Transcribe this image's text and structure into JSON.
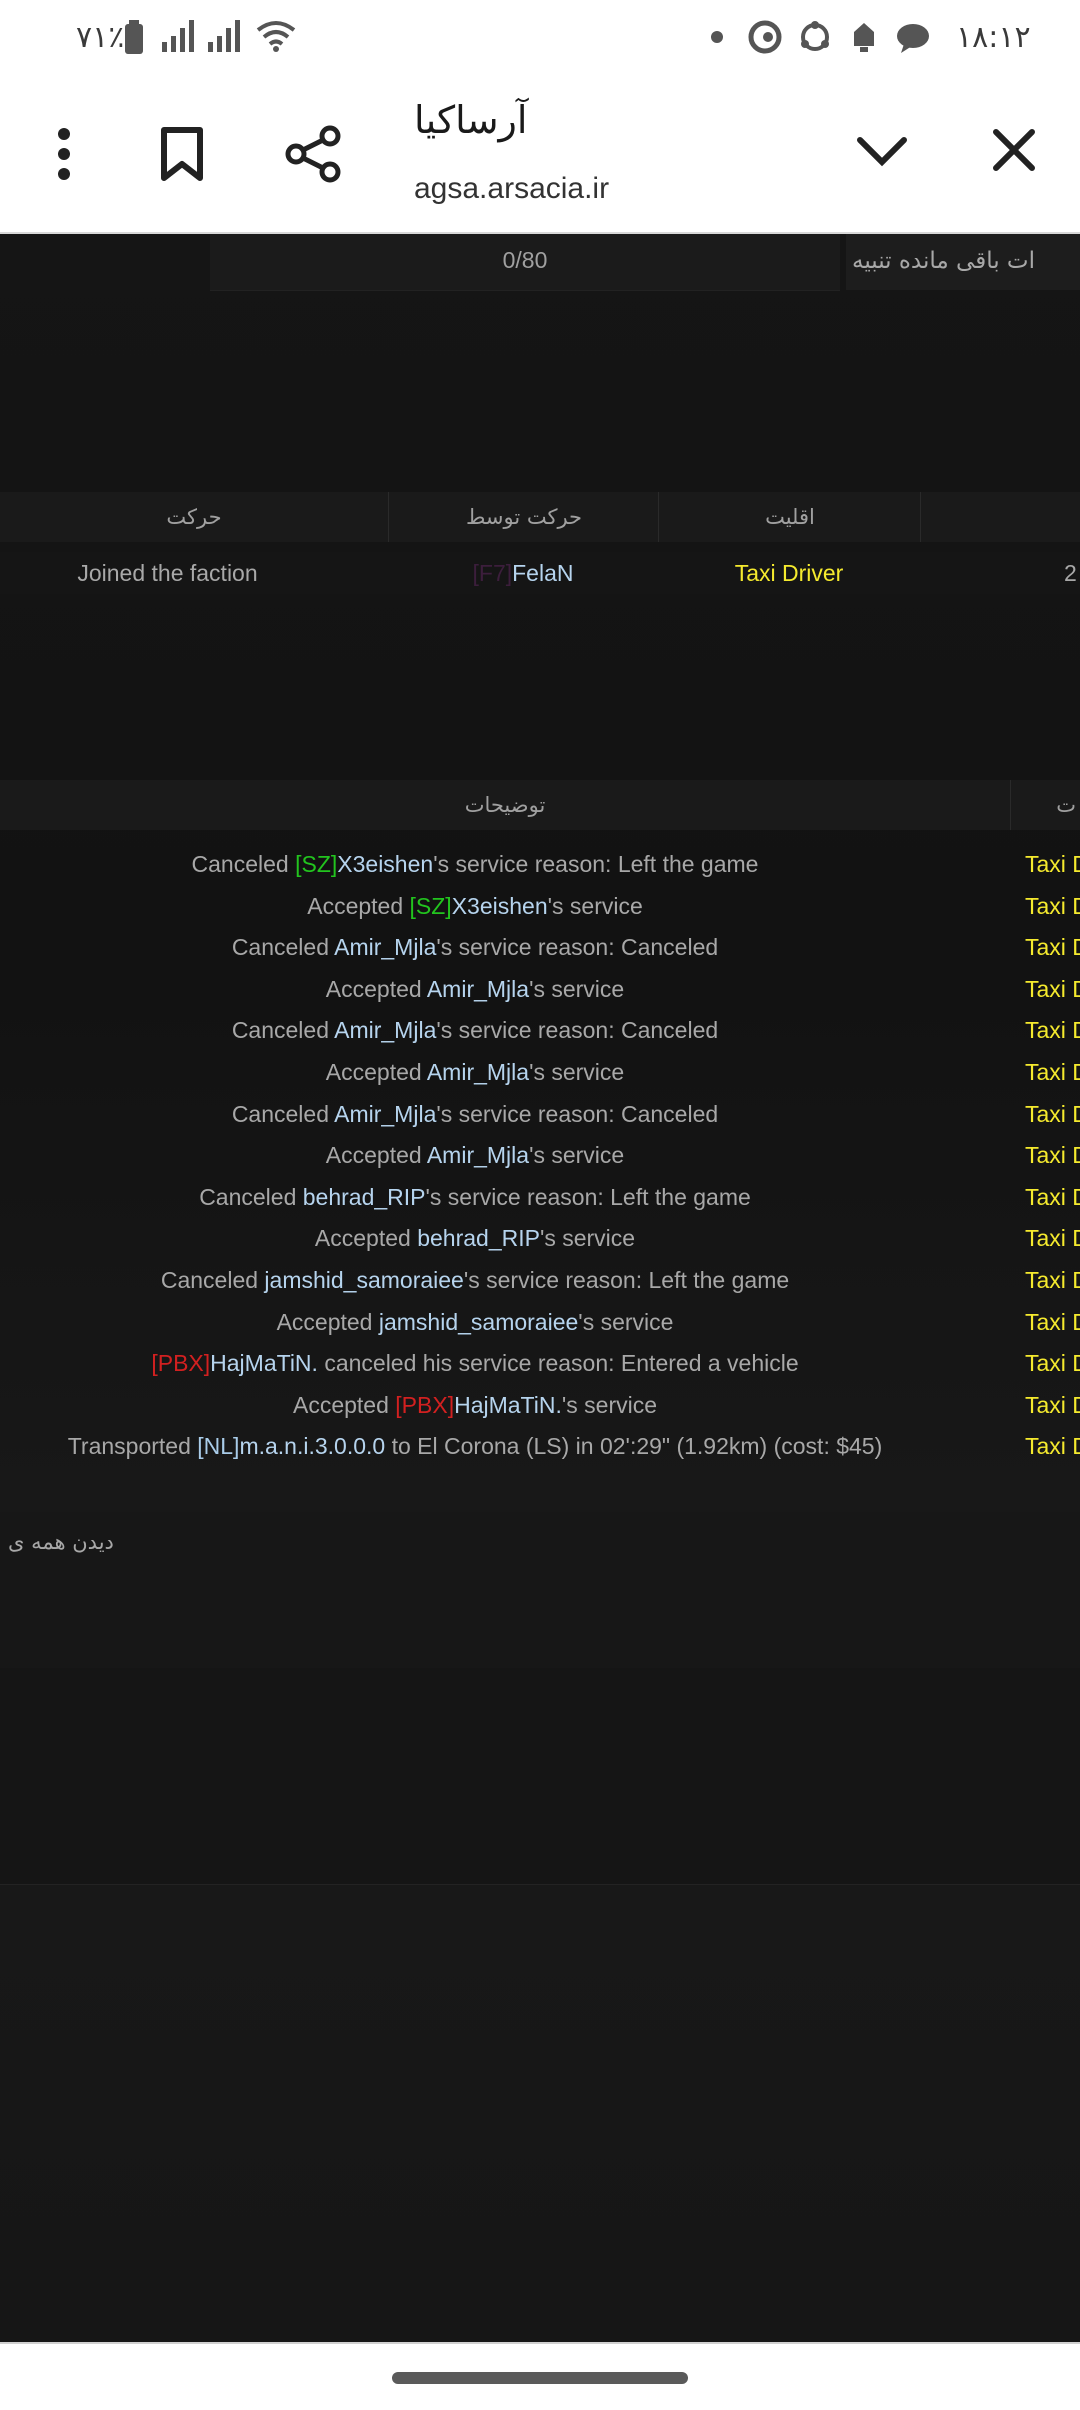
{
  "status_bar": {
    "battery_percent": "٧١٪",
    "time": "۱۸:۱۲"
  },
  "browser": {
    "page_title": "آرساکیا",
    "url": "agsa.arsacia.ir"
  },
  "warnings": {
    "label": "ات باقی مانده تنبیه",
    "value": "0/80"
  },
  "members_table": {
    "headers": [
      "حرکت",
      "حرکت توسط",
      "اقلیت"
    ],
    "row": {
      "action": "Joined the faction",
      "by_tag": "[F7]",
      "by_name": "FelaN",
      "rank": "Taxi Driver",
      "extra": "2"
    }
  },
  "logs_table": {
    "header_desc": "توضیحات",
    "header_rank_partial": "ت",
    "rank_partial": "Taxi D",
    "rows": [
      {
        "a": "Canceled ",
        "tag": "[SZ]",
        "tag_color": "green",
        "name": "X3eishen",
        "b": "'s service reason: Left the game"
      },
      {
        "a": "Accepted ",
        "tag": "[SZ]",
        "tag_color": "green",
        "name": "X3eishen",
        "b": "'s service"
      },
      {
        "a": "Canceled ",
        "tag": "",
        "tag_color": "",
        "name": "Amir_Mjla",
        "b": "'s service reason: Canceled"
      },
      {
        "a": "Accepted ",
        "tag": "",
        "tag_color": "",
        "name": "Amir_Mjla",
        "b": "'s service"
      },
      {
        "a": "Canceled ",
        "tag": "",
        "tag_color": "",
        "name": "Amir_Mjla",
        "b": "'s service reason: Canceled"
      },
      {
        "a": "Accepted ",
        "tag": "",
        "tag_color": "",
        "name": "Amir_Mjla",
        "b": "'s service"
      },
      {
        "a": "Canceled ",
        "tag": "",
        "tag_color": "",
        "name": "Amir_Mjla",
        "b": "'s service reason: Canceled"
      },
      {
        "a": "Accepted ",
        "tag": "",
        "tag_color": "",
        "name": "Amir_Mjla",
        "b": "'s service"
      },
      {
        "a": "Canceled ",
        "tag": "",
        "tag_color": "",
        "name": "behrad_RIP",
        "b": "'s service reason: Left the game"
      },
      {
        "a": "Accepted ",
        "tag": "",
        "tag_color": "",
        "name": "behrad_RIP",
        "b": "'s service"
      },
      {
        "a": "Canceled ",
        "tag": "",
        "tag_color": "",
        "name": "jamshid_samoraiee",
        "b": "'s service reason: Left the game"
      },
      {
        "a": "Accepted ",
        "tag": "",
        "tag_color": "",
        "name": "jamshid_samoraiee",
        "b": "'s service"
      },
      {
        "a": "",
        "tag": "[PBX]",
        "tag_color": "red",
        "name": "HajMaTiN.",
        "b": " canceled his service reason: Entered a vehicle"
      },
      {
        "a": "Accepted ",
        "tag": "[PBX]",
        "tag_color": "red",
        "name": "HajMaTiN.",
        "b": "'s service"
      },
      {
        "a": "Transported ",
        "tag": "[NL]",
        "tag_color": "blue",
        "name": "m.a.n.i.3.0.0.0",
        "b": " to El Corona (LS) in 02':29\" (1.92km) (cost: $45)"
      }
    ],
    "see_all": "دیدن همه ی"
  }
}
